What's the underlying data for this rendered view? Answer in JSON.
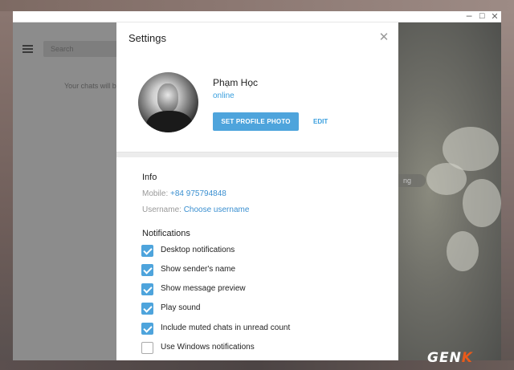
{
  "window": {
    "controls": {
      "minimize": "─",
      "maximize": "☐",
      "close": "✕"
    }
  },
  "left_panel": {
    "search_placeholder": "Search",
    "empty_text": "Your chats will b"
  },
  "right_area": {
    "pill_text": "ng"
  },
  "dialog": {
    "title": "Settings",
    "close_icon": "✕",
    "profile": {
      "name": "Phạm Học",
      "status": "online",
      "set_photo_label": "SET PROFILE PHOTO",
      "edit_label": "EDIT"
    },
    "info": {
      "title": "Info",
      "mobile_label": "Mobile:",
      "mobile_value": "+84 975794848",
      "username_label": "Username:",
      "username_value": "Choose username"
    },
    "notifications": {
      "title": "Notifications",
      "items": [
        {
          "label": "Desktop notifications",
          "checked": true
        },
        {
          "label": "Show sender's name",
          "checked": true
        },
        {
          "label": "Show message preview",
          "checked": true
        },
        {
          "label": "Play sound",
          "checked": true
        },
        {
          "label": "Include muted chats in unread count",
          "checked": true
        },
        {
          "label": "Use Windows notifications",
          "checked": false
        }
      ]
    }
  },
  "watermark": {
    "main": "GEN",
    "accent": "K"
  },
  "colors": {
    "accent": "#4ea4dc",
    "link": "#3a9fde",
    "overlay_dim": "#8c8c8c"
  }
}
